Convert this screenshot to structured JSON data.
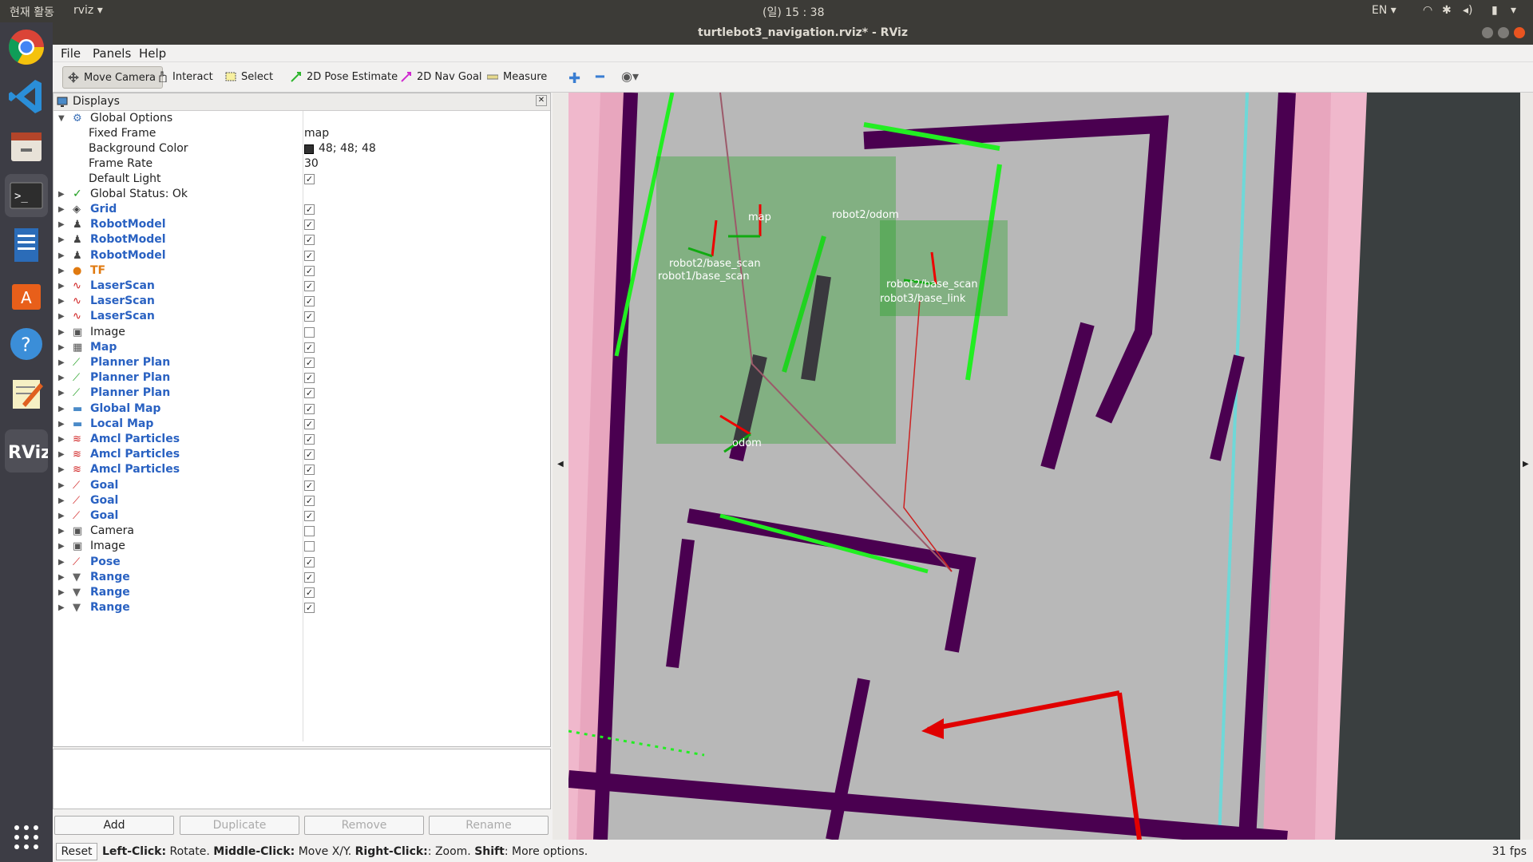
{
  "top_bar": {
    "activities": "현재 활동",
    "app_menu": "rviz",
    "clock": "(일) 15 : 38",
    "input_lang": "EN"
  },
  "window": {
    "title": "turtlebot3_navigation.rviz* - RViz"
  },
  "menu": [
    "File",
    "Panels",
    "Help"
  ],
  "toolbar": [
    {
      "label": "Move Camera",
      "icon": "move-camera-icon",
      "active": true
    },
    {
      "label": "Interact",
      "icon": "hand-icon"
    },
    {
      "label": "Select",
      "icon": "select-box-icon"
    },
    {
      "label": "2D Pose Estimate",
      "icon": "green-arrow-icon"
    },
    {
      "label": "2D Nav Goal",
      "icon": "pink-arrow-icon"
    },
    {
      "label": "Measure",
      "icon": "ruler-icon"
    }
  ],
  "displays_panel": {
    "title": "Displays",
    "global_options": {
      "label": "Global Options",
      "fixed_frame_label": "Fixed Frame",
      "fixed_frame_value": "map",
      "background_color_label": "Background Color",
      "background_color_value": "48; 48; 48",
      "frame_rate_label": "Frame Rate",
      "frame_rate_value": "30",
      "default_light_label": "Default Light"
    },
    "global_status": "Global Status: Ok",
    "items": [
      {
        "label": "Grid",
        "checked": true,
        "style": "blue"
      },
      {
        "label": "RobotModel",
        "checked": true,
        "style": "blue"
      },
      {
        "label": "RobotModel",
        "checked": true,
        "style": "blue"
      },
      {
        "label": "RobotModel",
        "checked": true,
        "style": "blue"
      },
      {
        "label": "TF",
        "checked": true,
        "style": "orange"
      },
      {
        "label": "LaserScan",
        "checked": true,
        "style": "blue"
      },
      {
        "label": "LaserScan",
        "checked": true,
        "style": "blue"
      },
      {
        "label": "LaserScan",
        "checked": true,
        "style": "blue"
      },
      {
        "label": "Image",
        "checked": false,
        "style": "plain"
      },
      {
        "label": "Map",
        "checked": true,
        "style": "blue"
      },
      {
        "label": "Planner Plan",
        "checked": true,
        "style": "blue"
      },
      {
        "label": "Planner Plan",
        "checked": true,
        "style": "blue"
      },
      {
        "label": "Planner Plan",
        "checked": true,
        "style": "blue"
      },
      {
        "label": "Global Map",
        "checked": true,
        "style": "blue"
      },
      {
        "label": "Local Map",
        "checked": true,
        "style": "blue"
      },
      {
        "label": "Amcl Particles",
        "checked": true,
        "style": "blue"
      },
      {
        "label": "Amcl Particles",
        "checked": true,
        "style": "blue"
      },
      {
        "label": "Amcl Particles",
        "checked": true,
        "style": "blue"
      },
      {
        "label": "Goal",
        "checked": true,
        "style": "blue"
      },
      {
        "label": "Goal",
        "checked": true,
        "style": "blue"
      },
      {
        "label": "Goal",
        "checked": true,
        "style": "blue"
      },
      {
        "label": "Camera",
        "checked": false,
        "style": "plain"
      },
      {
        "label": "Image",
        "checked": false,
        "style": "plain"
      },
      {
        "label": "Pose",
        "checked": true,
        "style": "blue"
      },
      {
        "label": "Range",
        "checked": true,
        "style": "blue"
      },
      {
        "label": "Range",
        "checked": true,
        "style": "blue"
      },
      {
        "label": "Range",
        "checked": true,
        "style": "blue"
      }
    ],
    "buttons": [
      "Add",
      "Duplicate",
      "Remove",
      "Rename"
    ]
  },
  "viewport_labels": [
    "map",
    "robot2/odom",
    "robot2/base_scan",
    "robot2/base_scan",
    "robot1/base_scan",
    "robot3/base_link",
    "odom"
  ],
  "status_bar": {
    "reset": "Reset",
    "hint_k1": "Left-Click:",
    "hint_v1": " Rotate. ",
    "hint_k2": "Middle-Click:",
    "hint_v2": " Move X/Y. ",
    "hint_k3": "Right-Click:",
    "hint_v3": ": Zoom. ",
    "hint_k4": "Shift",
    "hint_v4": ": More options.",
    "fps": "31 fps"
  },
  "colors": {
    "map_free": "#b8b8b8",
    "map_wall": "#4a0050",
    "costmap_inflation": "#f0b8cc",
    "laser": "#22ee22",
    "goal": "#e00000"
  }
}
